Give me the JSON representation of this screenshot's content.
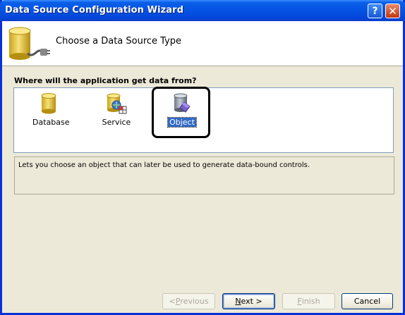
{
  "window": {
    "title": "Data Source Configuration Wizard",
    "help_glyph": "?",
    "close_glyph": "✕"
  },
  "header": {
    "title": "Choose a Data Source Type",
    "icon": "database-plug-icon"
  },
  "prompt": "Where will the application get data from?",
  "types": [
    {
      "label": "Database",
      "icon": "database-icon",
      "selected": false
    },
    {
      "label": "Service",
      "icon": "service-icon",
      "selected": false
    },
    {
      "label": "Object",
      "icon": "object-icon",
      "selected": true
    }
  ],
  "description": "Lets you choose an object that can later be used to generate data-bound controls.",
  "buttons": {
    "previous_prefix": "< ",
    "previous_mnemonic": "P",
    "previous_rest": "revious",
    "next_mnemonic": "N",
    "next_rest": "ext >",
    "finish_mnemonic": "F",
    "finish_rest": "inish",
    "cancel": "Cancel"
  },
  "colors": {
    "titlebar": "#0554e3",
    "selection": "#316ac5",
    "dialog_bg": "#ece9d8"
  }
}
